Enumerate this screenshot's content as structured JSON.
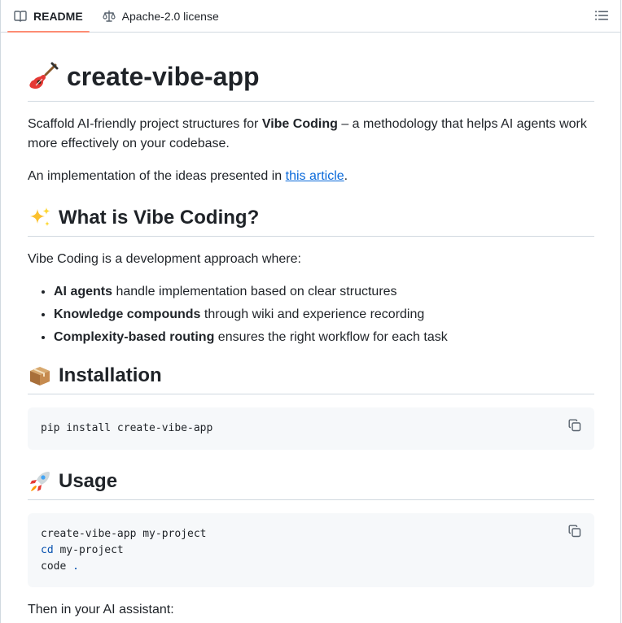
{
  "tabs": {
    "readme": "README",
    "license": "Apache-2.0 license"
  },
  "title": "create-vibe-app",
  "intro": {
    "p1_before": "Scaffold AI-friendly project structures for ",
    "p1_bold": "Vibe Coding",
    "p1_after": " – a methodology that helps AI agents work more effectively on your codebase.",
    "p2_before": "An implementation of the ideas presented in ",
    "p2_link": "this article",
    "p2_after": "."
  },
  "what": {
    "heading": "What is Vibe Coding?",
    "lead": "Vibe Coding is a development approach where:",
    "items": [
      {
        "bold": "AI agents",
        "rest": " handle implementation based on clear structures"
      },
      {
        "bold": "Knowledge compounds",
        "rest": " through wiki and experience recording"
      },
      {
        "bold": "Complexity-based routing",
        "rest": " ensures the right workflow for each task"
      }
    ]
  },
  "installation": {
    "heading": "Installation",
    "code": "pip install create-vibe-app"
  },
  "usage": {
    "heading": "Usage",
    "line1": "create-vibe-app my-project",
    "line2_kw": "cd",
    "line2_rest": " my-project",
    "line3_kw": "code",
    "line3_rest": " ."
  },
  "then": "Then in your AI assistant:",
  "icons": {
    "readme": "book-icon",
    "license": "scale-icon",
    "outline": "list-icon",
    "copy": "copy-icon",
    "title_emoji": "guitar-emoji",
    "what_emoji": "sparkles-emoji",
    "install_emoji": "package-emoji",
    "usage_emoji": "rocket-emoji"
  }
}
